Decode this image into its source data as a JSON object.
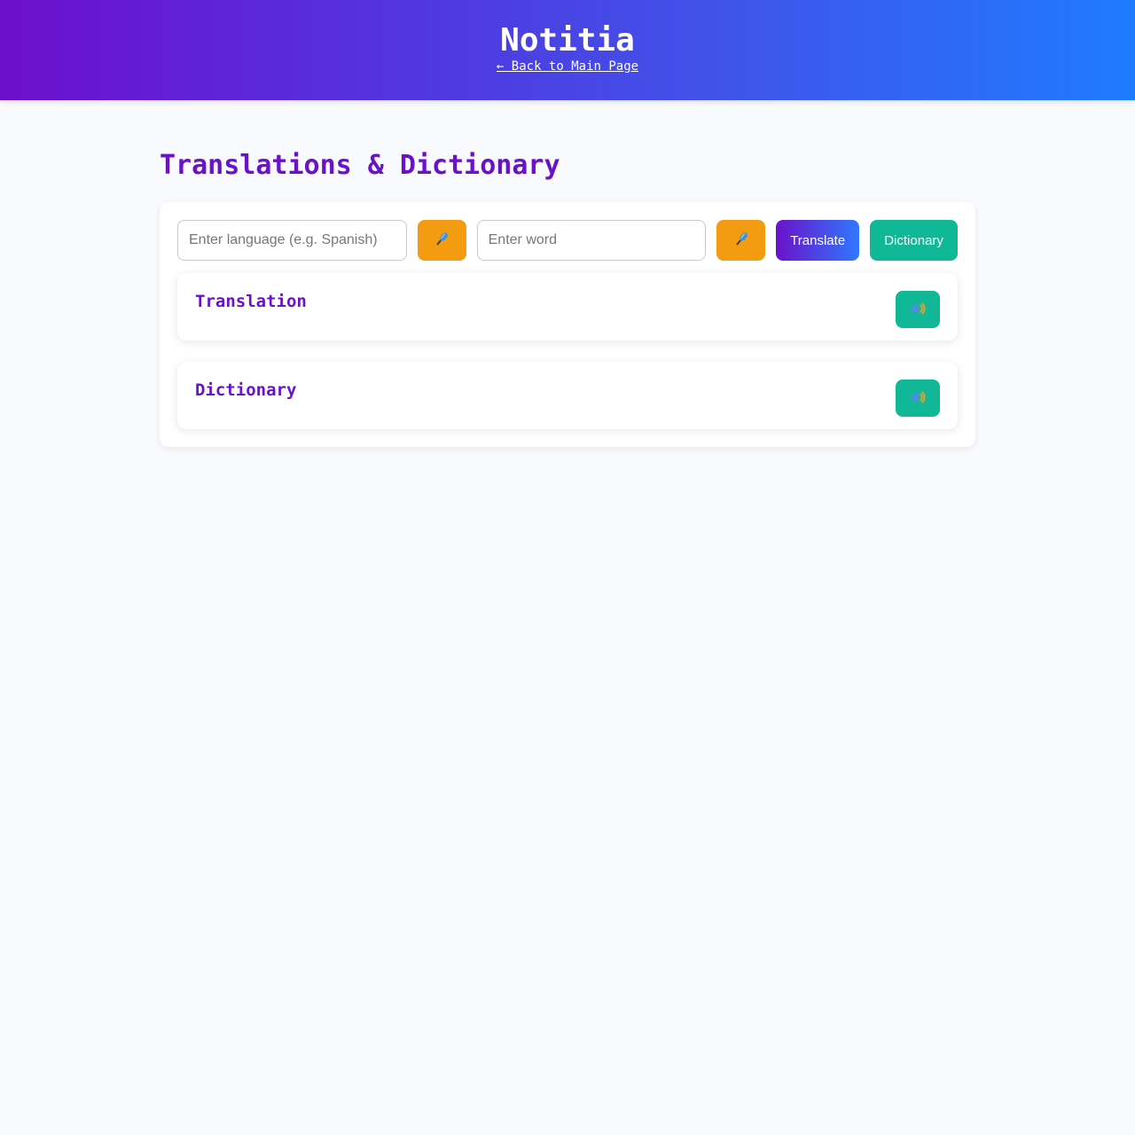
{
  "header": {
    "app_title": "Notitia",
    "back_link": "← Back to Main Page"
  },
  "page": {
    "title": "Translations & Dictionary"
  },
  "controls": {
    "language_placeholder": "Enter language (e.g. Spanish)",
    "language_value": "",
    "word_placeholder": "Enter word",
    "word_value": "",
    "translate_label": "Translate",
    "dictionary_label": "Dictionary",
    "mic_icon": "microphone-icon"
  },
  "results": {
    "translation_title": "Translation",
    "dictionary_title": "Dictionary",
    "speaker_icon": "speaker-icon"
  },
  "colors": {
    "accent_purple": "#6a12c9",
    "accent_blue": "#1f7bff",
    "mic_orange": "#f39c12",
    "teal": "#10b898",
    "background": "#f8fafd"
  }
}
